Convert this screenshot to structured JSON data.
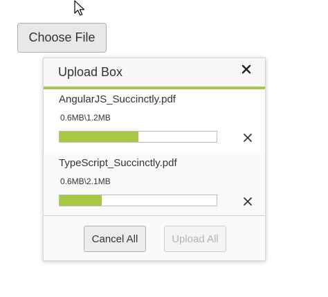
{
  "choose_file": {
    "label": "Choose File"
  },
  "upload_box": {
    "title": "Upload Box",
    "accent_color": "#a6c842",
    "close_icon": "close-icon",
    "files": [
      {
        "name": "AngularJS_Succinctly.pdf",
        "size_text": "0.6MB\\1.2MB",
        "progress": 0.5
      },
      {
        "name": "TypeScript_Succinctly.pdf",
        "size_text": "0.6MB\\2.1MB",
        "progress": 0.27
      }
    ],
    "remove_icon": "close-icon",
    "footer": {
      "cancel_all_label": "Cancel All",
      "upload_all_label": "Upload All",
      "upload_all_disabled": true
    }
  },
  "cursor_icon": "mouse-pointer-icon"
}
